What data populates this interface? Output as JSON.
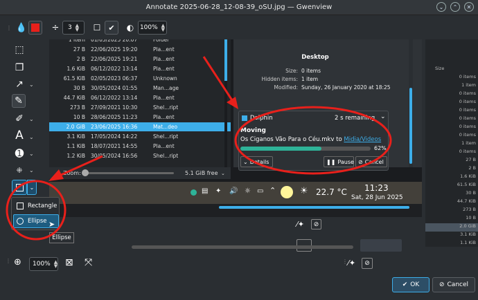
{
  "window": {
    "title": "Annotate 2025-06-28_12-08-39_oSU.jpg — Gwenview"
  },
  "toolbar": {
    "stroke_width": "3",
    "opacity": "100%"
  },
  "files": [
    {
      "size": "1 item",
      "date": "01/05/2025 20:07",
      "type": "Folder"
    },
    {
      "size": "27 B",
      "date": "22/06/2025 19:20",
      "type": "Pla...ent"
    },
    {
      "size": "2 B",
      "date": "22/06/2025 19:21",
      "type": "Pla...ent"
    },
    {
      "size": "1.6 KiB",
      "date": "06/12/2022 13:14",
      "type": "Pla...ent"
    },
    {
      "size": "61.5 KiB",
      "date": "02/05/2023 06:37",
      "type": "Unknown"
    },
    {
      "size": "30 B",
      "date": "30/05/2024 01:55",
      "type": "Man...age"
    },
    {
      "size": "44.7 KiB",
      "date": "06/12/2022 13:14",
      "type": "Pla...ent"
    },
    {
      "size": "273 B",
      "date": "27/09/2021 10:30",
      "type": "Shel...ript"
    },
    {
      "size": "10 B",
      "date": "28/06/2025 11:23",
      "type": "Pla...ent"
    },
    {
      "size": "2.0 GiB",
      "date": "23/06/2025 16:36",
      "type": "Mat...deo"
    },
    {
      "size": "3.1 KiB",
      "date": "17/05/2024 14:22",
      "type": "Shel...ript"
    },
    {
      "size": "1.1 KiB",
      "date": "18/07/2021 14:55",
      "type": "Pla...ent"
    },
    {
      "size": "1.2 KiB",
      "date": "30/05/2024 16:56",
      "type": "Shel...ript"
    }
  ],
  "zoom": {
    "label": "Zoom:",
    "free": "5.1 GiB free"
  },
  "info": {
    "title": "Desktop",
    "size_k": "Size:",
    "size_v": "0 items",
    "hidden_k": "Hidden items:",
    "hidden_v": "1 item",
    "mod_k": "Modified:",
    "mod_v": "Sunday, 26 January 2020 at 18:25"
  },
  "notif": {
    "app": "Dolphin",
    "remaining": "2 s remaining",
    "title": "Moving",
    "file_text": "Os Ciganos Vão Para o Céu.mkv to ",
    "dest": "Midia/Videos",
    "percent": "62%",
    "progress": 0.62,
    "details": "Details",
    "pause": "Pause",
    "cancel": "Cancel"
  },
  "taskbar": {
    "temp": "22.7 °C",
    "time": "11:23",
    "date": "Sat, 28 Jun 2025"
  },
  "shape_menu": {
    "rectangle": "Rectangle",
    "ellipse": "Ellipse"
  },
  "tooltip": "Ellipse",
  "bottom": {
    "zoom": "100%",
    "ok": "OK",
    "cancel": "Cancel"
  },
  "right_panel": {
    "header": "Size",
    "rows": [
      "0 items",
      "1 item",
      "0 items",
      "0 items",
      "0 items",
      "0 items",
      "0 items",
      "0 items",
      "1 item",
      "0 items",
      "27 B",
      "2 B",
      "1.6 KiB",
      "61.5 KiB",
      "30 B",
      "44.7 KiB",
      "273 B",
      "10 B",
      "2.0 GiB",
      "3.1 KiB",
      "1.1 KiB"
    ]
  },
  "colors": {
    "accent": "#3daee9",
    "annotation": "#e8201b",
    "progress": "#2eb398"
  }
}
